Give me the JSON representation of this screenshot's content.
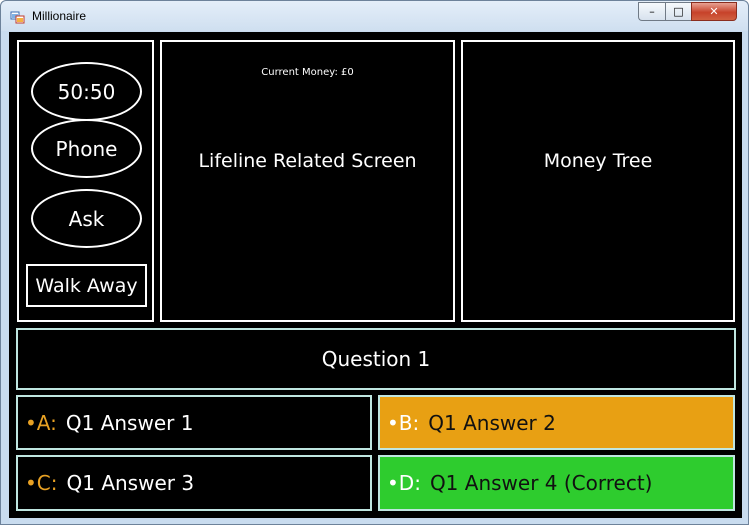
{
  "window": {
    "title": "Millionaire",
    "controls": {
      "minimize": "–",
      "maximize": "□",
      "close": "✕"
    }
  },
  "lifelines": {
    "fifty_fifty": "50:50",
    "phone": "Phone",
    "ask": "Ask",
    "walk_away": "Walk Away"
  },
  "lifeline_screen": {
    "current_money": "Current Money: £0",
    "label": "Lifeline Related Screen"
  },
  "money_tree": {
    "label": "Money Tree"
  },
  "question": {
    "text": "Question 1"
  },
  "answers": [
    {
      "letter": "•A:",
      "text": "Q1 Answer 1",
      "state": "default"
    },
    {
      "letter": "•B:",
      "text": "Q1 Answer 2",
      "state": "selected"
    },
    {
      "letter": "•C:",
      "text": "Q1 Answer 3",
      "state": "default"
    },
    {
      "letter": "•D:",
      "text": "Q1 Answer 4 (Correct)",
      "state": "correct"
    }
  ],
  "colors": {
    "selected": "#e8a013",
    "correct": "#2ecc2e",
    "letter": "#e8a123",
    "answer_border": "#bfe6e0"
  }
}
